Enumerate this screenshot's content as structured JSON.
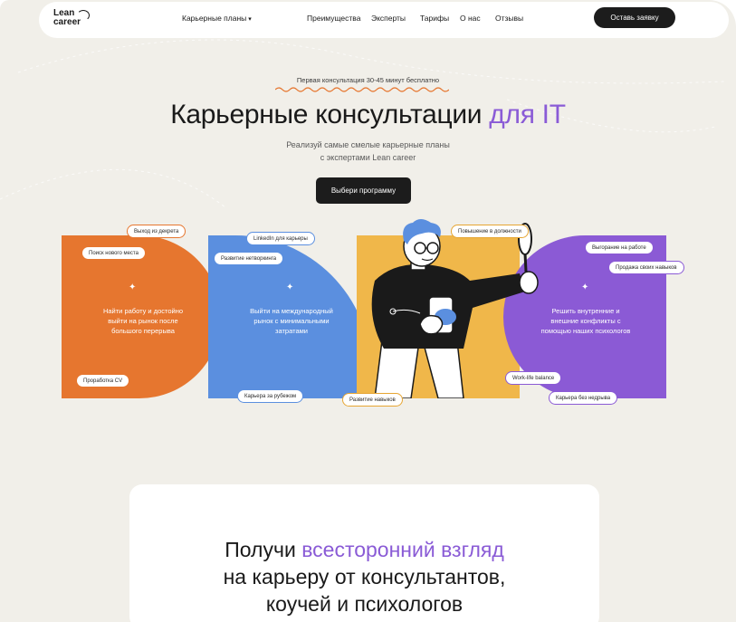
{
  "nav": {
    "logo_line1": "Lean",
    "logo_line2": "career",
    "links": {
      "career_plans": "Карьерные планы",
      "advantages": "Преимущества",
      "experts": "Эксперты",
      "tariffs": "Тарифы",
      "about": "О нас",
      "reviews": "Отзывы"
    },
    "cta": "Оставь заявку"
  },
  "hero": {
    "pretitle": "Первая консультация 30-45 минут бесплатно",
    "title_main": "Карьерные консультации ",
    "title_accent": "для IT",
    "subtitle_line1": "Реализуй самые смелые карьерные планы",
    "subtitle_line2": "с экспертами Lean career",
    "cta": "Выбери программу"
  },
  "blocks": {
    "orange": {
      "line1": "Найти работу и достойно",
      "line2": "выйти на рынок после",
      "line3": "большого перерыва",
      "color": "#e6762f"
    },
    "blue": {
      "line1": "Выйти на международный",
      "line2": "рынок с минимальными",
      "line3": "затратами",
      "color": "#5b8fdf"
    },
    "yellow": {
      "color": "#f0b74a"
    },
    "purple": {
      "line1": "Решить внутренние и",
      "line2": "внешние конфликты с",
      "line3": "помощью наших психологов",
      "color": "#8b5ad5"
    }
  },
  "pills": {
    "exit_maternity": "Выход из декрета",
    "new_job": "Поиск нового места",
    "cv": "Проработка CV",
    "linkedin": "LinkedIn для карьеры",
    "networking": "Развитие нетворкинга",
    "abroad": "Карьера за рубежом",
    "promotion": "Повышение в должности",
    "skills": "Развитие навыков",
    "burnout": "Выгорание на работе",
    "sell_skills": "Продажа своих навыков",
    "work_life": "Work-life balance",
    "no_overwork": "Карьера без недрыва"
  },
  "section2": {
    "line1_main": "Получи ",
    "line1_accent": "всесторонний взгляд",
    "line2": "на карьеру от консультантов,",
    "line3": "коучей и психологов"
  },
  "colors": {
    "background": "#f1efe9",
    "accent_purple": "#8a5bd6",
    "dark": "#1c1c1c"
  }
}
